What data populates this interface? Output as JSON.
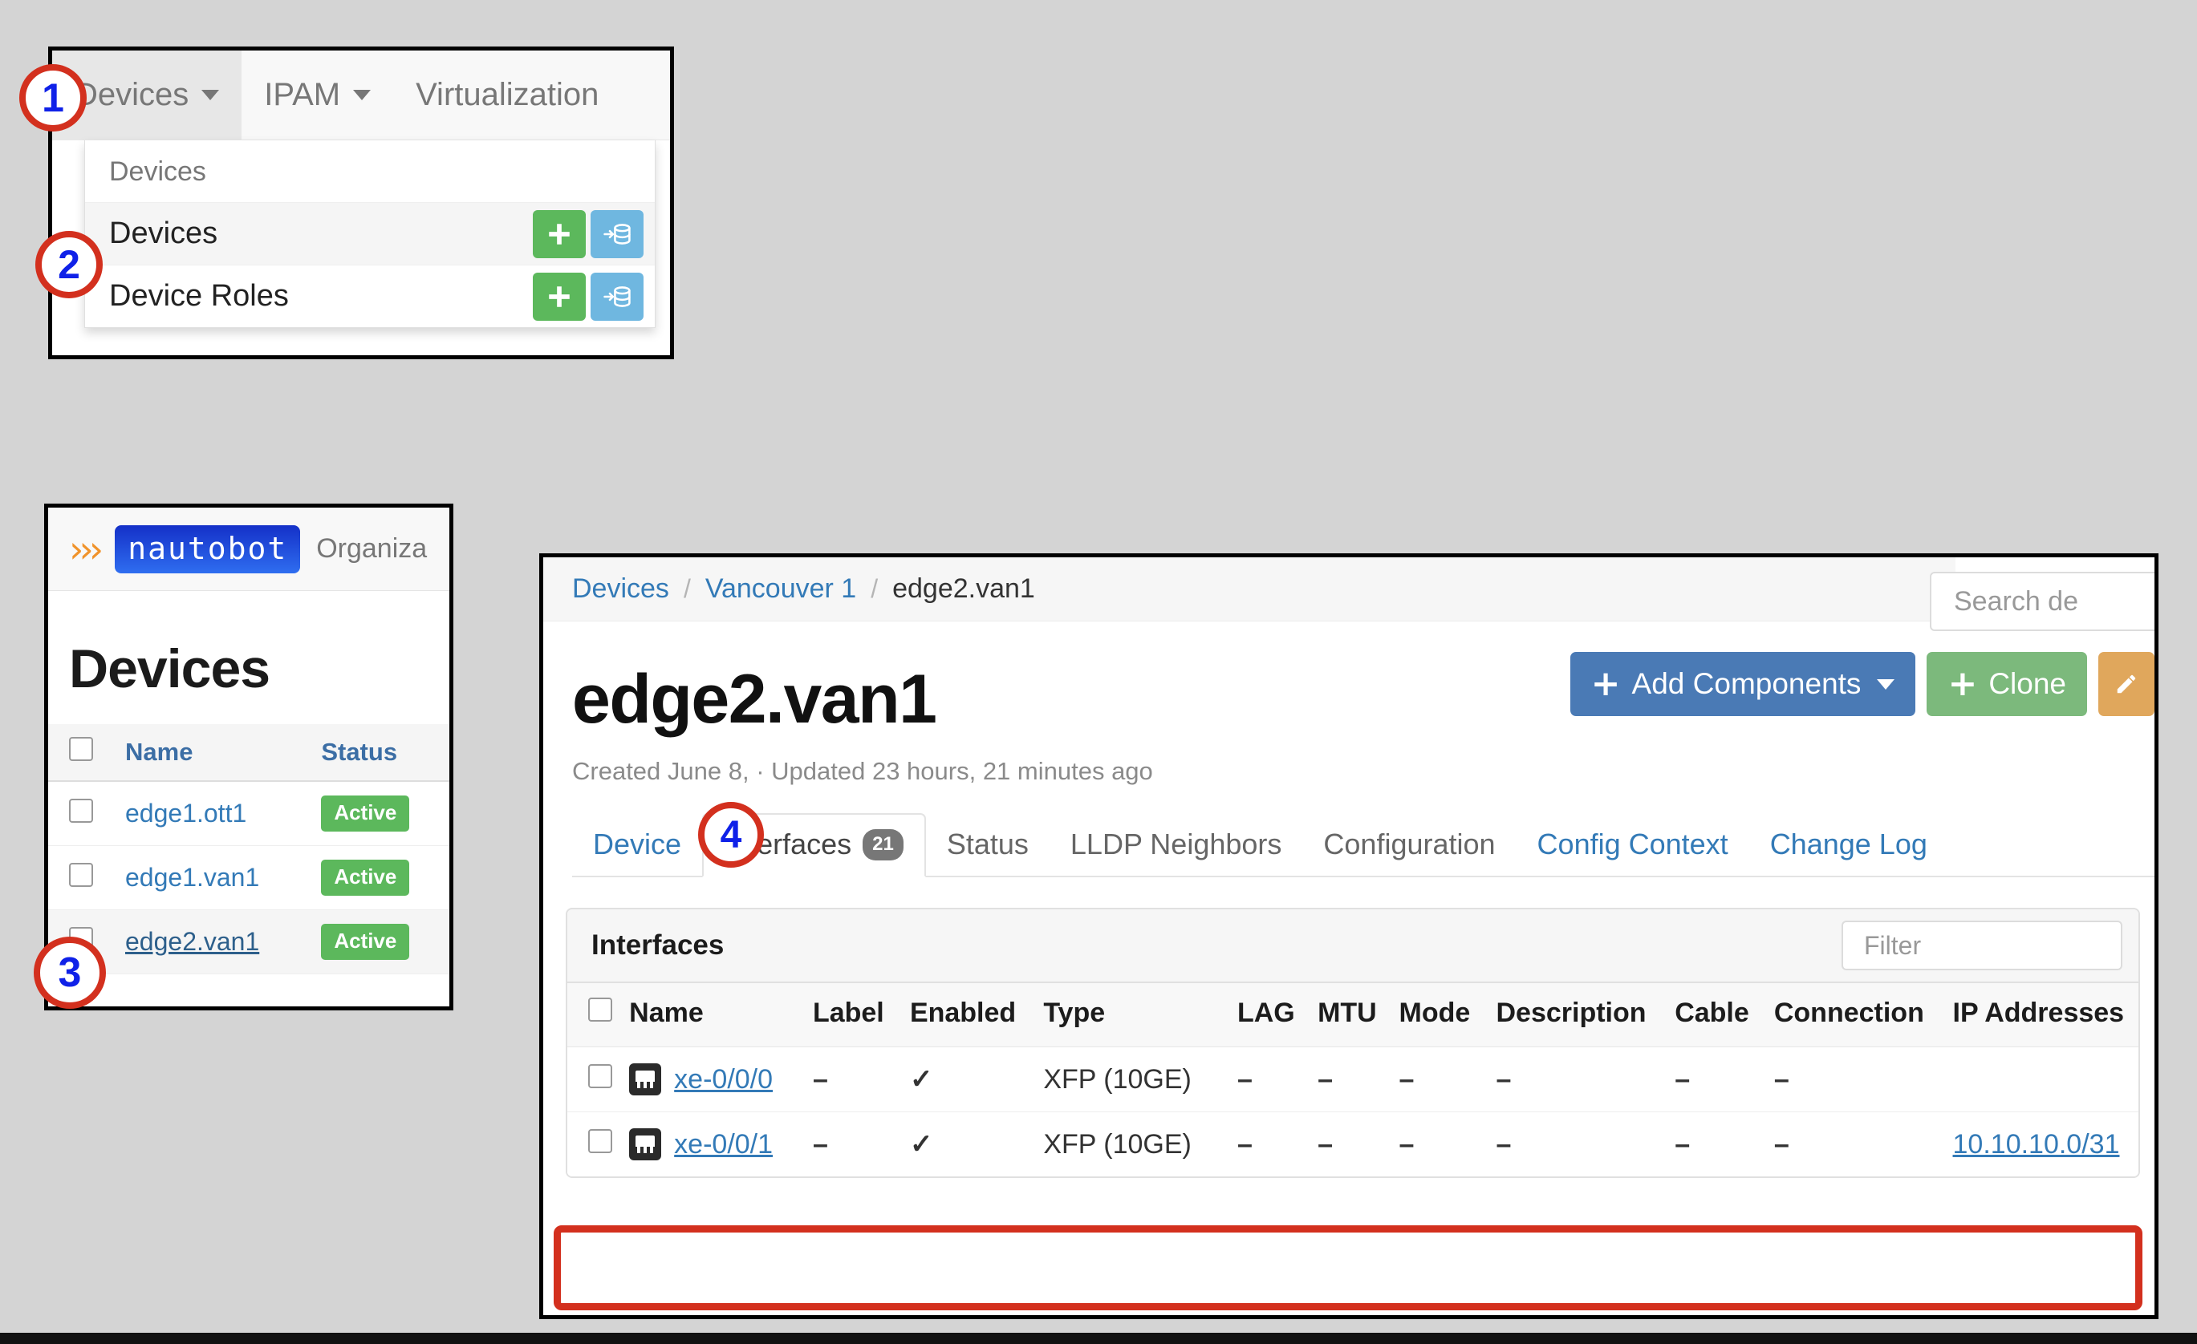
{
  "callouts": [
    {
      "number": "1"
    },
    {
      "number": "2"
    },
    {
      "number": "3"
    },
    {
      "number": "4"
    }
  ],
  "nav_panel": {
    "items": [
      {
        "label": "Devices",
        "has_caret": true,
        "open": true
      },
      {
        "label": "IPAM",
        "has_caret": true,
        "open": false
      },
      {
        "label": "Virtualization",
        "has_caret": false,
        "open": false
      }
    ],
    "dropdown": {
      "group_header": "Devices",
      "rows": [
        {
          "label": "Devices",
          "add_icon": "plus-icon",
          "import_icon": "database-import-icon",
          "highlighted": true
        },
        {
          "label": "Device Roles",
          "add_icon": "plus-icon",
          "import_icon": "database-import-icon",
          "highlighted": false
        }
      ]
    }
  },
  "list_panel": {
    "brand": {
      "chevrons": "›››",
      "logo_text": "nautobot"
    },
    "nav_organization": "Organiza",
    "title": "Devices",
    "columns": [
      "Name",
      "Status"
    ],
    "rows": [
      {
        "name": "edge1.ott1",
        "status": "Active",
        "selected": false
      },
      {
        "name": "edge1.van1",
        "status": "Active",
        "selected": false
      },
      {
        "name": "edge2.van1",
        "status": "Active",
        "selected": true
      }
    ]
  },
  "detail_panel": {
    "breadcrumb": [
      {
        "label": "Devices",
        "link": true
      },
      {
        "label": "Vancouver 1",
        "link": true
      },
      {
        "label": "edge2.van1",
        "link": false
      }
    ],
    "breadcrumb_separator": "/",
    "search": {
      "placeholder": "Search de",
      "value": ""
    },
    "buttons": [
      {
        "label": "Add Components",
        "icon": "plus-icon",
        "color": "#4a7ab5",
        "caret": true
      },
      {
        "label": "Clone",
        "icon": "plus-icon",
        "color": "#7cb97c",
        "caret": false
      },
      {
        "label": "",
        "icon": "pencil-icon",
        "color": "#e0a75c",
        "caret": false
      }
    ],
    "title": "edge2.van1",
    "meta": "Created June 8,  · Updated 23 hours, 21 minutes ago",
    "meta_created": "Created June 8",
    "meta_updated": "· Updated 23 hours, 21 minutes ago",
    "tabs": [
      {
        "label": "Device",
        "badge": "",
        "active": false
      },
      {
        "label": "Interfaces",
        "badge": "21",
        "active": true
      },
      {
        "label": "Status",
        "badge": "",
        "active": false
      },
      {
        "label": "LLDP Neighbors",
        "badge": "",
        "active": false
      },
      {
        "label": "Configuration",
        "badge": "",
        "active": false
      },
      {
        "label": "Config Context",
        "badge": "",
        "active": false
      },
      {
        "label": "Change Log",
        "badge": "",
        "active": false
      }
    ],
    "card": {
      "title": "Interfaces",
      "filter_placeholder": "Filter",
      "columns": [
        "Name",
        "Label",
        "Enabled",
        "Type",
        "LAG",
        "MTU",
        "Mode",
        "Description",
        "Cable",
        "Connection",
        "IP Addresses"
      ],
      "rows": [
        {
          "icon": "rj45-interface-icon",
          "name": "xe-0/0/0",
          "label": "–",
          "enabled": "✓",
          "type": "XFP (10GE)",
          "lag": "–",
          "mtu": "–",
          "mode": "–",
          "description": "–",
          "cable": "–",
          "connection": "–",
          "ip_addresses": "",
          "highlighted": false
        },
        {
          "icon": "rj45-interface-icon",
          "name": "xe-0/0/1",
          "label": "–",
          "enabled": "✓",
          "type": "XFP (10GE)",
          "lag": "–",
          "mtu": "–",
          "mode": "–",
          "description": "–",
          "cable": "–",
          "connection": "–",
          "ip_addresses": "10.10.10.0/31",
          "highlighted": true
        }
      ]
    }
  },
  "colors": {
    "callout_ring": "#d3301e",
    "callout_number": "#0f21e8",
    "link": "#337ab7",
    "active_badge": "#5cb85c",
    "add_components": "#4a7ab5",
    "clone": "#7cb97c",
    "edit": "#e0a75c",
    "highlight": "#d3301e",
    "page_bg": "#d4d4d4"
  }
}
